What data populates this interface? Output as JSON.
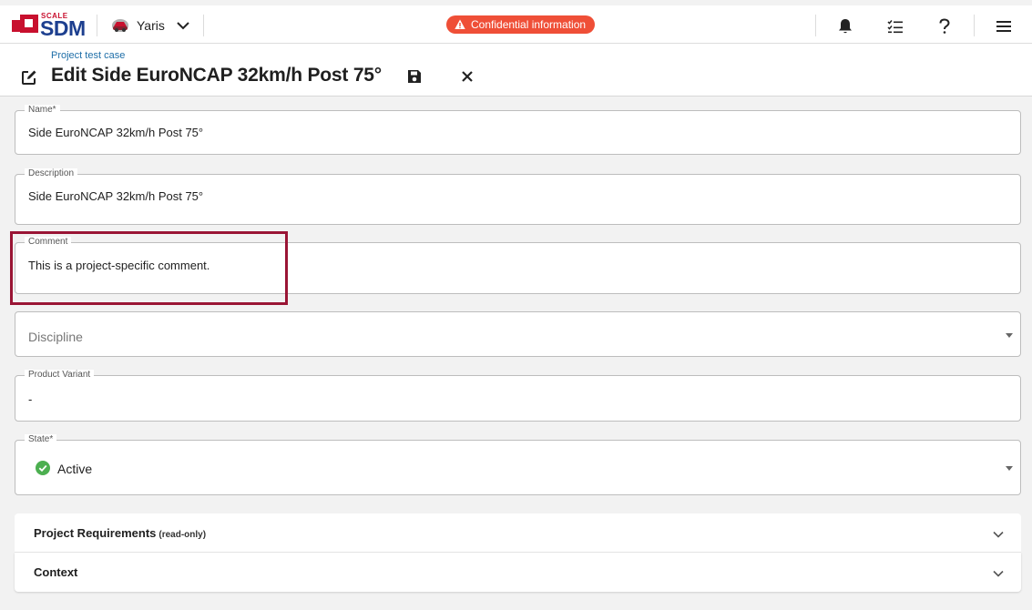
{
  "app": {
    "logo_small": "SCALE",
    "logo_big": "SDM",
    "project": "Yaris",
    "confidential_label": "Confidential information",
    "icons": [
      "car-icon",
      "chevron-down-icon",
      "warning-icon",
      "bell-icon",
      "task-list-icon",
      "help-icon",
      "menu-icon"
    ]
  },
  "header": {
    "breadcrumb": "Project test case",
    "title": "Edit Side EuroNCAP 32km/h Post 75°",
    "icons": [
      "edit-icon",
      "save-icon",
      "close-icon"
    ]
  },
  "form": {
    "name": {
      "label": "Name*",
      "value": "Side EuroNCAP 32km/h Post 75°"
    },
    "description": {
      "label": "Description",
      "value": "Side EuroNCAP 32km/h Post 75°"
    },
    "comment": {
      "label": "Comment",
      "value": "This is a project-specific comment."
    },
    "discipline": {
      "placeholder": "Discipline"
    },
    "product_variant": {
      "label": "Product Variant",
      "value": "-"
    },
    "state": {
      "label": "State*",
      "value": "Active",
      "status_color": "#4caf50"
    }
  },
  "accordions": {
    "requirements": {
      "title": "Project Requirements",
      "note": "(read-only)"
    },
    "context": {
      "title": "Context"
    }
  },
  "colors": {
    "brand_red": "#c8102e",
    "brand_blue": "#1d3f8f",
    "confidential_bg": "#ef4f37",
    "highlight": "#9a1535",
    "link": "#1e6ea8"
  }
}
